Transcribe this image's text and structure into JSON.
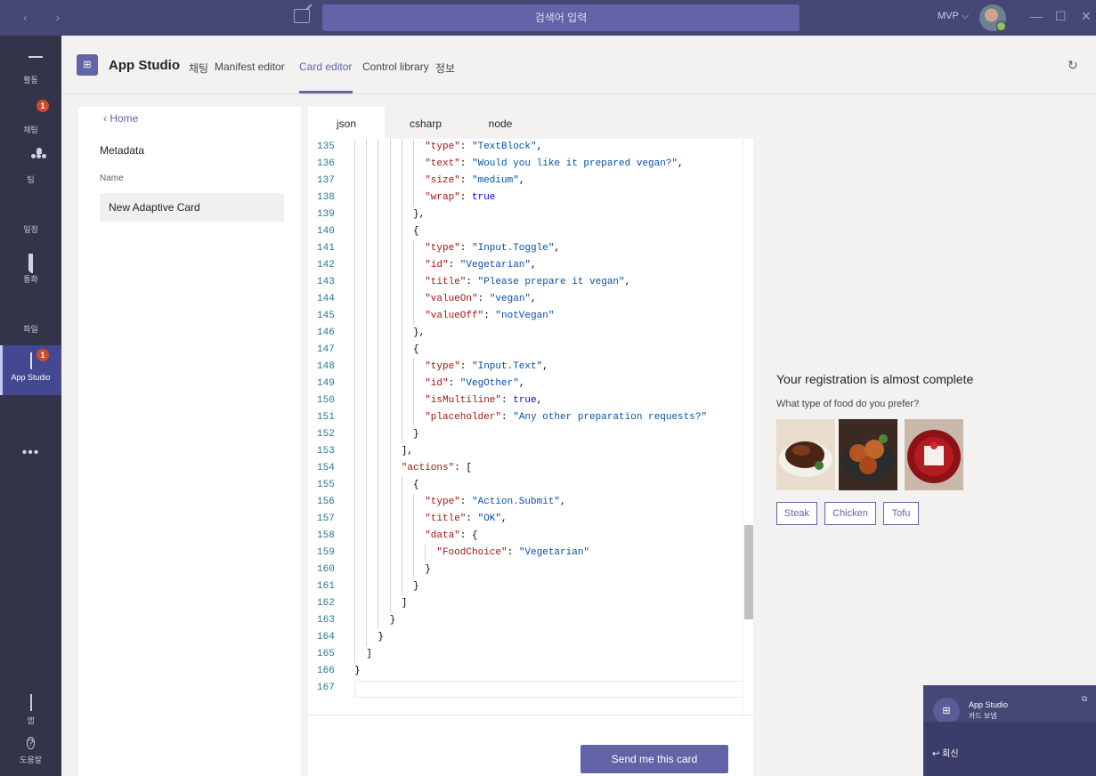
{
  "titlebar": {
    "search_placeholder": "검색어 입력",
    "user_menu": "MVP ⌵"
  },
  "rail": {
    "items": [
      {
        "label": "활동",
        "icon": "bell-icon"
      },
      {
        "label": "채팅",
        "icon": "chat-icon",
        "badge": "1"
      },
      {
        "label": "팀",
        "icon": "teams-icon"
      },
      {
        "label": "일정",
        "icon": "calendar-icon"
      },
      {
        "label": "통화",
        "icon": "phone-icon"
      },
      {
        "label": "파일",
        "icon": "file-icon"
      },
      {
        "label": "App Studio",
        "icon": "app-studio-icon",
        "badge": "1"
      }
    ],
    "more": "•••",
    "bottom": [
      {
        "label": "앱",
        "icon": "apps-icon"
      },
      {
        "label": "도움말",
        "icon": "help-icon"
      }
    ]
  },
  "app": {
    "title": "App Studio",
    "tabs": [
      "채팅",
      "Manifest editor",
      "Card editor",
      "Control library",
      "정보"
    ],
    "active_tab": "Card editor"
  },
  "meta": {
    "back": "Home",
    "section": "Metadata",
    "name_label": "Name",
    "name_value": "New Adaptive Card"
  },
  "editor": {
    "tabs": [
      "json",
      "csharp",
      "node"
    ],
    "active_tab": "json",
    "send_label": "Send me this card",
    "lines": [
      {
        "n": "135",
        "t": [
          [
            "k",
            "\"type\""
          ],
          [
            "p",
            ": "
          ],
          [
            "s",
            "\"TextBlock\""
          ],
          [
            "p",
            ","
          ]
        ]
      },
      {
        "n": "136",
        "t": [
          [
            "k",
            "\"text\""
          ],
          [
            "p",
            ": "
          ],
          [
            "s",
            "\"Would you like it prepared vegan?\""
          ],
          [
            "p",
            ","
          ]
        ]
      },
      {
        "n": "137",
        "t": [
          [
            "k",
            "\"size\""
          ],
          [
            "p",
            ": "
          ],
          [
            "s",
            "\"medium\""
          ],
          [
            "p",
            ","
          ]
        ]
      },
      {
        "n": "138",
        "t": [
          [
            "k",
            "\"wrap\""
          ],
          [
            "p",
            ": "
          ],
          [
            "b",
            "true"
          ]
        ]
      },
      {
        "n": "139",
        "t": [
          [
            "p",
            "},"
          ]
        ]
      },
      {
        "n": "140",
        "t": [
          [
            "p",
            "{"
          ]
        ]
      },
      {
        "n": "141",
        "t": [
          [
            "k",
            "\"type\""
          ],
          [
            "p",
            ": "
          ],
          [
            "s",
            "\"Input.Toggle\""
          ],
          [
            "p",
            ","
          ]
        ]
      },
      {
        "n": "142",
        "t": [
          [
            "k",
            "\"id\""
          ],
          [
            "p",
            ": "
          ],
          [
            "s",
            "\"Vegetarian\""
          ],
          [
            "p",
            ","
          ]
        ]
      },
      {
        "n": "143",
        "t": [
          [
            "k",
            "\"title\""
          ],
          [
            "p",
            ": "
          ],
          [
            "s",
            "\"Please prepare it vegan\""
          ],
          [
            "p",
            ","
          ]
        ]
      },
      {
        "n": "144",
        "t": [
          [
            "k",
            "\"valueOn\""
          ],
          [
            "p",
            ": "
          ],
          [
            "s",
            "\"vegan\""
          ],
          [
            "p",
            ","
          ]
        ]
      },
      {
        "n": "145",
        "t": [
          [
            "k",
            "\"valueOff\""
          ],
          [
            "p",
            ": "
          ],
          [
            "s",
            "\"notVegan\""
          ]
        ]
      },
      {
        "n": "146",
        "t": [
          [
            "p",
            "},"
          ]
        ]
      },
      {
        "n": "147",
        "t": [
          [
            "p",
            "{"
          ]
        ]
      },
      {
        "n": "148",
        "t": [
          [
            "k",
            "\"type\""
          ],
          [
            "p",
            ": "
          ],
          [
            "s",
            "\"Input.Text\""
          ],
          [
            "p",
            ","
          ]
        ]
      },
      {
        "n": "149",
        "t": [
          [
            "k",
            "\"id\""
          ],
          [
            "p",
            ": "
          ],
          [
            "s",
            "\"VegOther\""
          ],
          [
            "p",
            ","
          ]
        ]
      },
      {
        "n": "150",
        "t": [
          [
            "k",
            "\"isMultiline\""
          ],
          [
            "p",
            ": "
          ],
          [
            "b",
            "true"
          ],
          [
            "p",
            ","
          ]
        ]
      },
      {
        "n": "151",
        "t": [
          [
            "k",
            "\"placeholder\""
          ],
          [
            "p",
            ": "
          ],
          [
            "s",
            "\"Any other preparation requests?\""
          ]
        ]
      },
      {
        "n": "152",
        "t": [
          [
            "p",
            "}"
          ]
        ]
      },
      {
        "n": "153",
        "t": [
          [
            "p",
            "],"
          ]
        ]
      },
      {
        "n": "154",
        "t": [
          [
            "k",
            "\"actions\""
          ],
          [
            "p",
            ": ["
          ]
        ]
      },
      {
        "n": "155",
        "t": [
          [
            "p",
            "{"
          ]
        ]
      },
      {
        "n": "156",
        "t": [
          [
            "k",
            "\"type\""
          ],
          [
            "p",
            ": "
          ],
          [
            "s",
            "\"Action.Submit\""
          ],
          [
            "p",
            ","
          ]
        ]
      },
      {
        "n": "157",
        "t": [
          [
            "k",
            "\"title\""
          ],
          [
            "p",
            ": "
          ],
          [
            "s",
            "\"OK\""
          ],
          [
            "p",
            ","
          ]
        ]
      },
      {
        "n": "158",
        "t": [
          [
            "k",
            "\"data\""
          ],
          [
            "p",
            ": {"
          ]
        ]
      },
      {
        "n": "159",
        "t": [
          [
            "k",
            "\"FoodChoice\""
          ],
          [
            "p",
            ": "
          ],
          [
            "s",
            "\"Vegetarian\""
          ]
        ]
      },
      {
        "n": "160",
        "t": [
          [
            "p",
            "}"
          ]
        ]
      },
      {
        "n": "161",
        "t": [
          [
            "p",
            "}"
          ]
        ]
      },
      {
        "n": "162",
        "t": [
          [
            "p",
            "]"
          ]
        ]
      },
      {
        "n": "163",
        "t": [
          [
            "p",
            "}"
          ]
        ]
      },
      {
        "n": "164",
        "t": [
          [
            "p",
            "}"
          ]
        ]
      },
      {
        "n": "165",
        "t": [
          [
            "p",
            "]"
          ]
        ]
      },
      {
        "n": "166",
        "t": [
          [
            "p",
            "}"
          ]
        ]
      },
      {
        "n": "167",
        "t": []
      }
    ]
  },
  "preview": {
    "title": "Your registration is almost complete",
    "subtitle": "What type of food do you prefer?",
    "images": [
      "steak-image",
      "chicken-image",
      "tofu-image"
    ],
    "choices": [
      "Steak",
      "Chicken",
      "Tofu"
    ]
  },
  "toast": {
    "title": "App Studio",
    "message": "카드 보냄",
    "reply": "회신"
  },
  "colors": {
    "accent": "#6264a7",
    "titlebar": "#464775",
    "rail": "#33344a",
    "badge": "#cc4a31"
  }
}
